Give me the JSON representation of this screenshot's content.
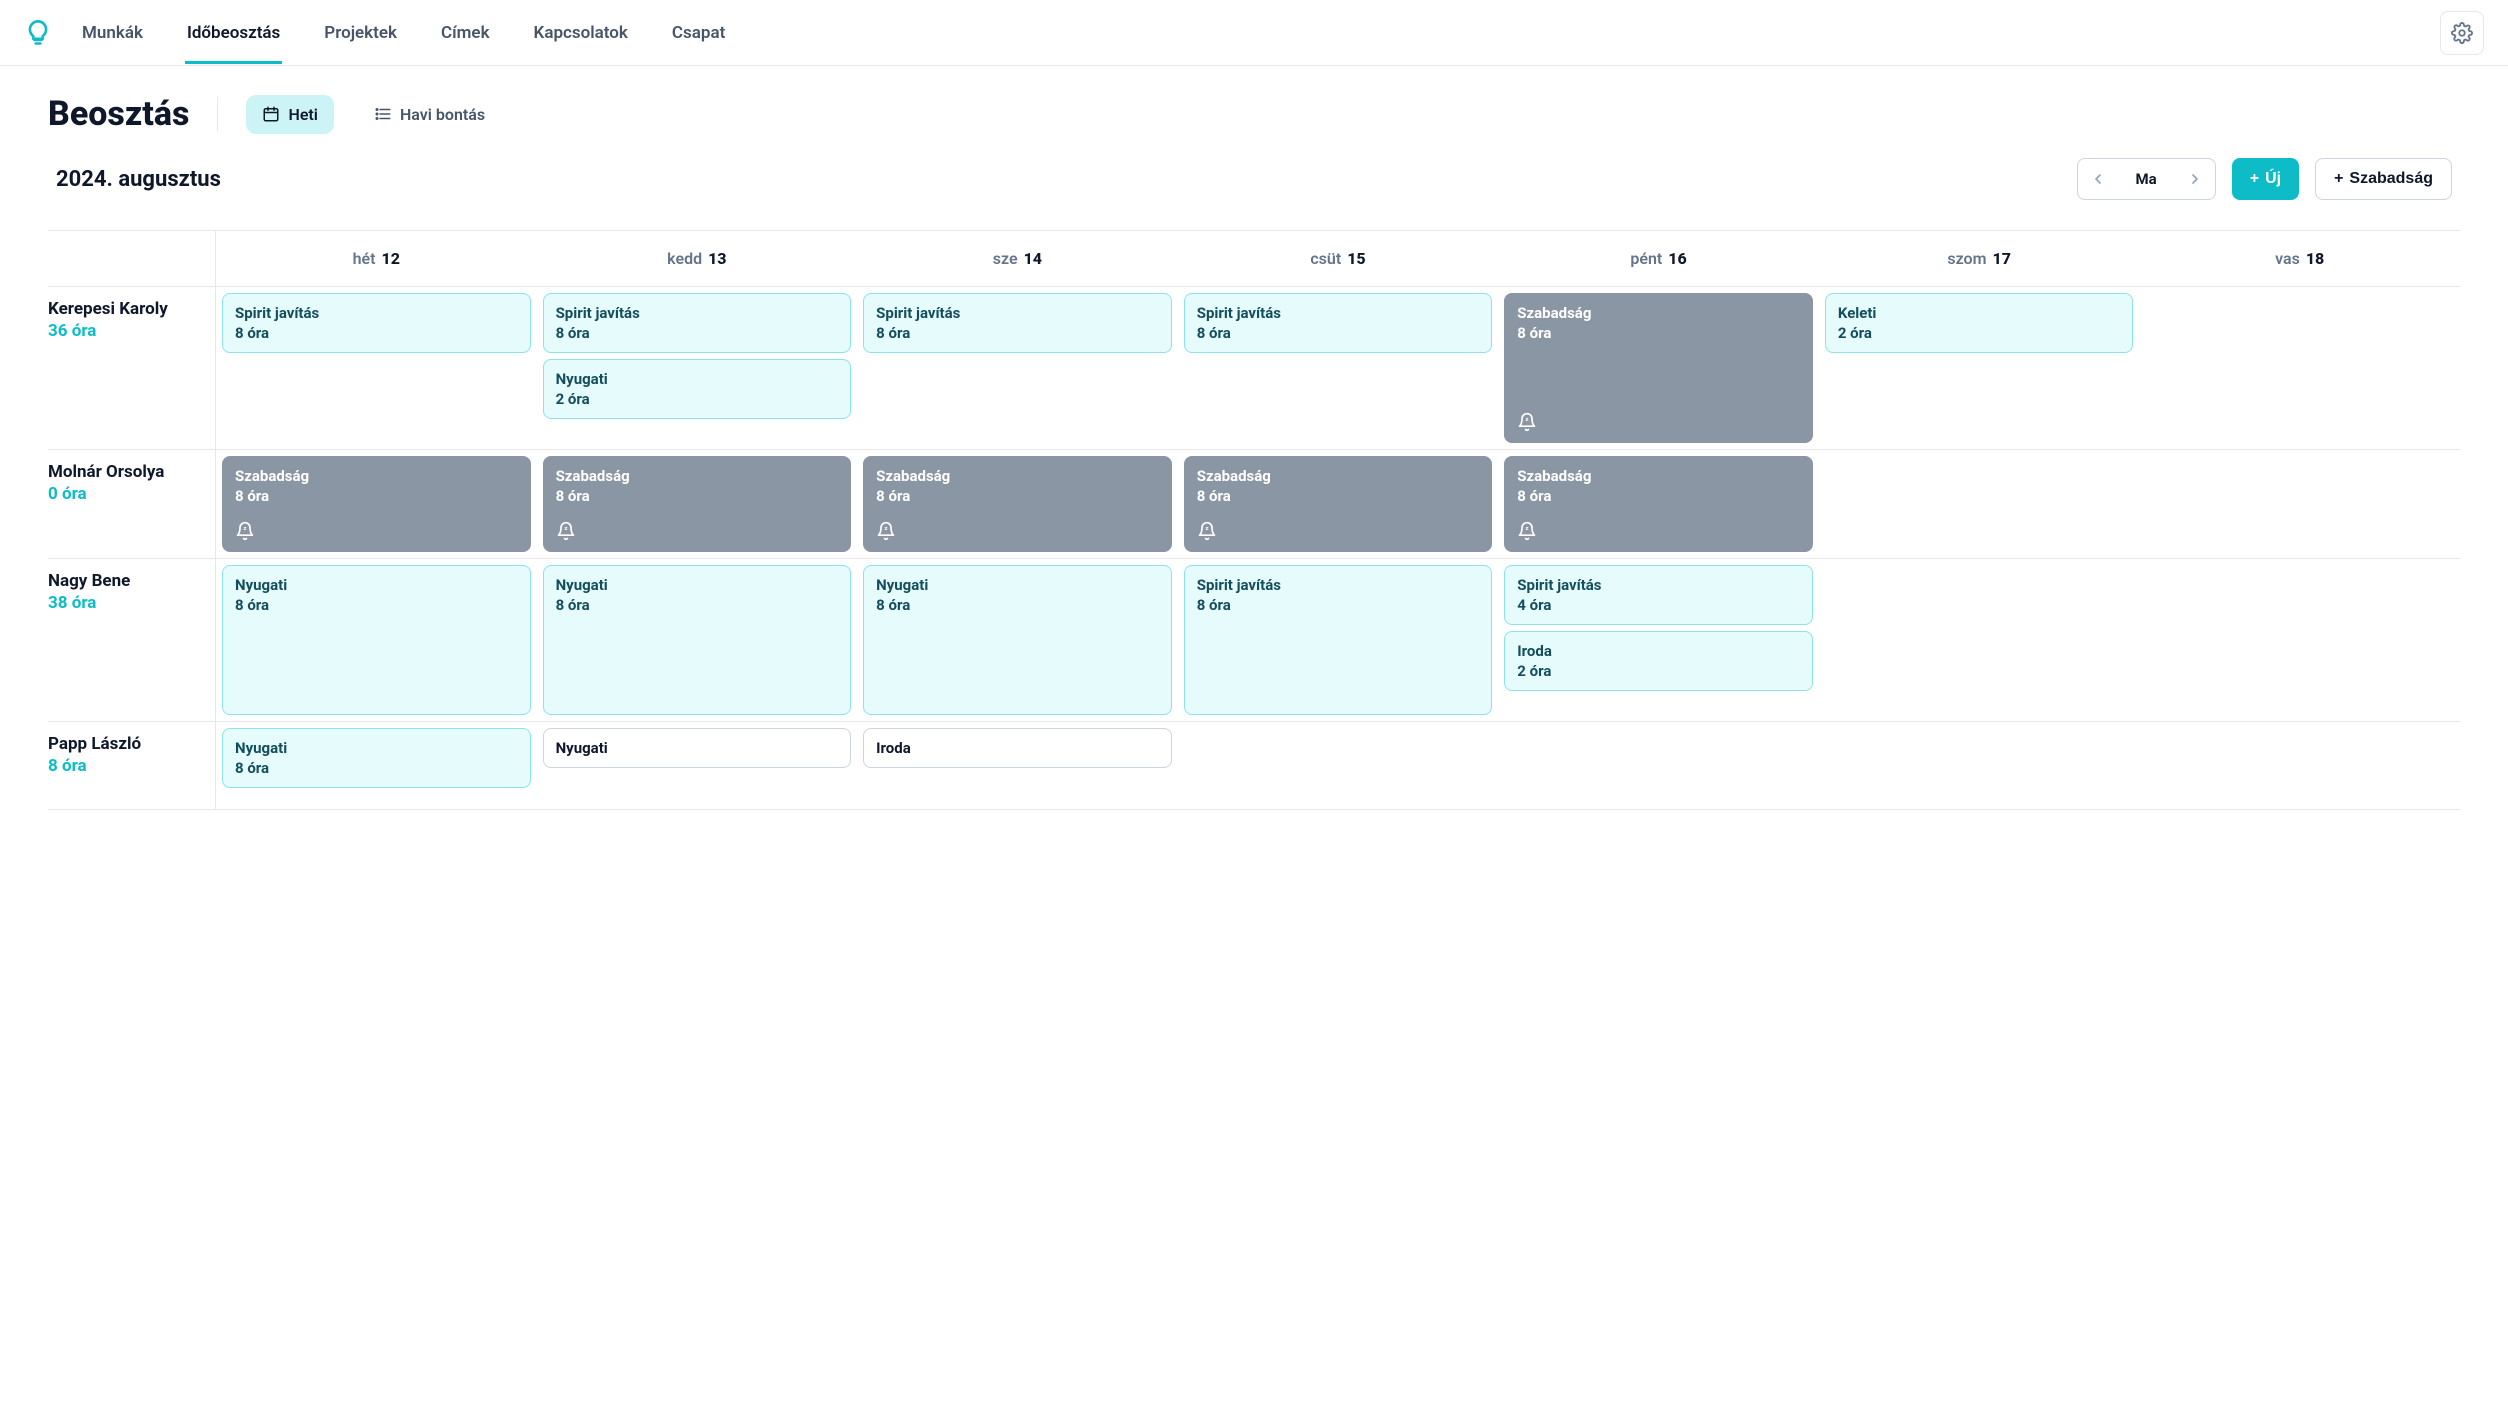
{
  "nav": {
    "items": [
      "Munkák",
      "Időbeosztás",
      "Projektek",
      "Címek",
      "Kapcsolatok",
      "Csapat"
    ],
    "active_index": 1
  },
  "page": {
    "title": "Beosztás",
    "view_weekly_label": "Heti",
    "view_monthly_label": "Havi bontás",
    "month_label": "2024. augusztus",
    "today_label": "Ma",
    "new_button_label": "Új",
    "vacation_button_label": "Szabadság"
  },
  "days": [
    {
      "short": "hét",
      "num": "12"
    },
    {
      "short": "kedd",
      "num": "13"
    },
    {
      "short": "sze",
      "num": "14"
    },
    {
      "short": "csüt",
      "num": "15"
    },
    {
      "short": "pént",
      "num": "16"
    },
    {
      "short": "szom",
      "num": "17"
    },
    {
      "short": "vas",
      "num": "18"
    }
  ],
  "rows": [
    {
      "name": "Kerepesi Karoly",
      "hours": "36 óra",
      "cells": [
        [
          {
            "title": "Spirit javítás",
            "hours": "8 óra",
            "type": "teal"
          }
        ],
        [
          {
            "title": "Spirit javítás",
            "hours": "8 óra",
            "type": "teal"
          },
          {
            "title": "Nyugati",
            "hours": "2 óra",
            "type": "teal"
          }
        ],
        [
          {
            "title": "Spirit javítás",
            "hours": "8 óra",
            "type": "teal"
          }
        ],
        [
          {
            "title": "Spirit javítás",
            "hours": "8 óra",
            "type": "teal"
          }
        ],
        [
          {
            "title": "Szabadság",
            "hours": "8 óra",
            "type": "gray",
            "bell": true,
            "tall": true
          }
        ],
        [
          {
            "title": "Keleti",
            "hours": "2 óra",
            "type": "teal"
          }
        ],
        []
      ]
    },
    {
      "name": "Molnár Orsolya",
      "hours": "0 óra",
      "cells": [
        [
          {
            "title": "Szabadság",
            "hours": "8 óra",
            "type": "gray",
            "bell": true,
            "mid": true
          }
        ],
        [
          {
            "title": "Szabadság",
            "hours": "8 óra",
            "type": "gray",
            "bell": true,
            "mid": true
          }
        ],
        [
          {
            "title": "Szabadság",
            "hours": "8 óra",
            "type": "gray",
            "bell": true,
            "mid": true
          }
        ],
        [
          {
            "title": "Szabadság",
            "hours": "8 óra",
            "type": "gray",
            "bell": true,
            "mid": true
          }
        ],
        [
          {
            "title": "Szabadság",
            "hours": "8 óra",
            "type": "gray",
            "bell": true,
            "mid": true
          }
        ],
        [],
        []
      ]
    },
    {
      "name": "Nagy Bene",
      "hours": "38 óra",
      "cells": [
        [
          {
            "title": "Nyugati",
            "hours": "8 óra",
            "type": "teal",
            "tall": true
          }
        ],
        [
          {
            "title": "Nyugati",
            "hours": "8 óra",
            "type": "teal",
            "tall": true
          }
        ],
        [
          {
            "title": "Nyugati",
            "hours": "8 óra",
            "type": "teal",
            "tall": true
          }
        ],
        [
          {
            "title": "Spirit javítás",
            "hours": "8 óra",
            "type": "teal",
            "tall": true
          }
        ],
        [
          {
            "title": "Spirit javítás",
            "hours": "4 óra",
            "type": "teal"
          },
          {
            "title": "Iroda",
            "hours": "2 óra",
            "type": "teal"
          }
        ],
        [],
        []
      ]
    },
    {
      "name": "Papp László",
      "hours": "8 óra",
      "cells": [
        [
          {
            "title": "Nyugati",
            "hours": "8 óra",
            "type": "teal"
          }
        ],
        [
          {
            "title": "Nyugati",
            "hours": "",
            "type": "white"
          }
        ],
        [
          {
            "title": "Iroda",
            "hours": "",
            "type": "white"
          }
        ],
        [],
        [],
        [],
        []
      ]
    }
  ]
}
